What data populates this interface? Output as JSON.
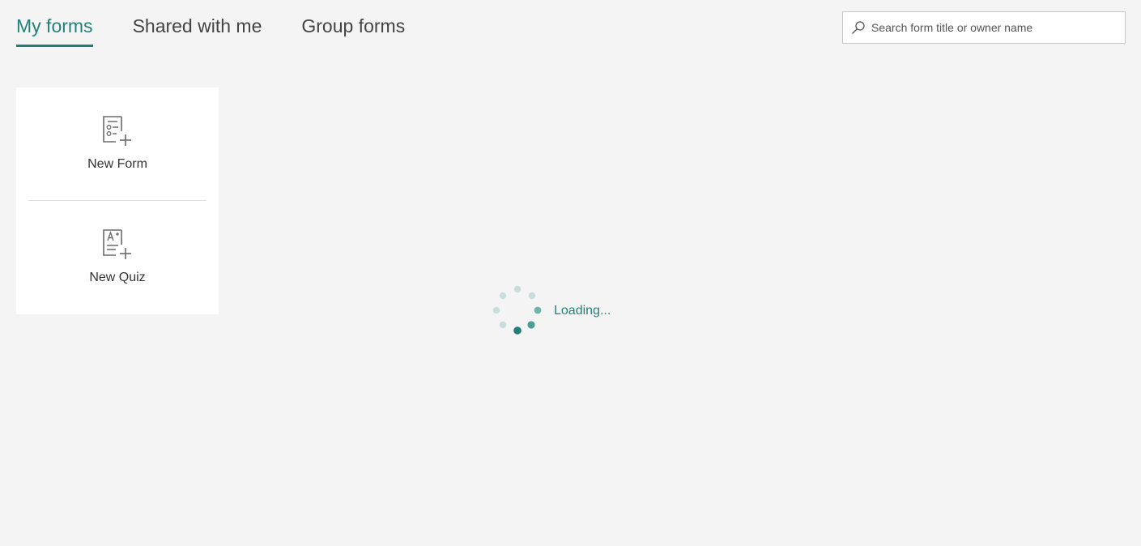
{
  "tabs": [
    {
      "label": "My forms",
      "active": true
    },
    {
      "label": "Shared with me",
      "active": false
    },
    {
      "label": "Group forms",
      "active": false
    }
  ],
  "search": {
    "placeholder": "Search form title or owner name",
    "value": ""
  },
  "new_items": {
    "form_label": "New Form",
    "form_icon": "new-form-icon",
    "quiz_label": "New Quiz",
    "quiz_icon": "new-quiz-icon"
  },
  "status": {
    "loading_text": "Loading..."
  },
  "colors": {
    "accent": "#1f7f76",
    "background": "#f4f4f4"
  }
}
